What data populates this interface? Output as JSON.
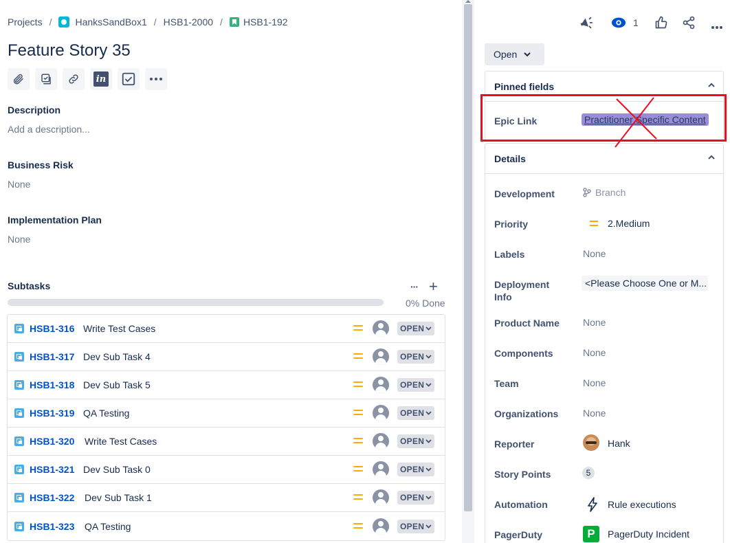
{
  "breadcrumb": {
    "projects": "Projects",
    "project": "HanksSandBox1",
    "epic": "HSB1-2000",
    "issue": "HSB1-192",
    "separator": "/"
  },
  "issue": {
    "title": "Feature Story 35"
  },
  "toolbar": {
    "invision_label": "in",
    "more_label": "···"
  },
  "fields": {
    "description": {
      "label": "Description",
      "value": "Add a description..."
    },
    "business_risk": {
      "label": "Business Risk",
      "value": "None"
    },
    "implementation_plan": {
      "label": "Implementation Plan",
      "value": "None"
    }
  },
  "subtasks": {
    "label": "Subtasks",
    "more_label": "···",
    "add_label": "+",
    "progress_percent": 0,
    "progress_label": "0% Done",
    "status_label": "OPEN",
    "items": [
      {
        "key": "HSB1-316",
        "summary": "Write Test Cases"
      },
      {
        "key": "HSB1-317",
        "summary": "Dev Sub Task 4"
      },
      {
        "key": "HSB1-318",
        "summary": "Dev Sub Task 5"
      },
      {
        "key": "HSB1-319",
        "summary": "QA Testing"
      },
      {
        "key": "HSB1-320",
        "summary": "Write Test Cases"
      },
      {
        "key": "HSB1-321",
        "summary": "Dev Sub Task 0"
      },
      {
        "key": "HSB1-322",
        "summary": "Dev Sub Task 1"
      },
      {
        "key": "HSB1-323",
        "summary": "QA Testing"
      }
    ]
  },
  "top_actions": {
    "watchers_count": "1"
  },
  "status_button": {
    "label": "Open"
  },
  "pinned": {
    "title": "Pinned fields",
    "epic_link_label": "Epic Link",
    "epic_link_value": "Practitioner Specific Content"
  },
  "details": {
    "title": "Details",
    "development": {
      "label": "Development",
      "value": "Branch"
    },
    "priority": {
      "label": "Priority",
      "value": "2.Medium"
    },
    "labels": {
      "label": "Labels",
      "value": "None"
    },
    "deployment_info": {
      "label_line1": "Deployment",
      "label_line2": "Info",
      "value": "<Please Choose One or M..."
    },
    "product_name": {
      "label": "Product Name",
      "value": "None"
    },
    "components": {
      "label": "Components",
      "value": "None"
    },
    "team": {
      "label": "Team",
      "value": "None"
    },
    "organizations": {
      "label": "Organizations",
      "value": "None"
    },
    "reporter": {
      "label": "Reporter",
      "value": "Hank"
    },
    "story_points": {
      "label": "Story Points",
      "value": "5"
    },
    "automation": {
      "label": "Automation",
      "value": "Rule executions"
    },
    "pagerduty": {
      "label": "PagerDuty",
      "value": "PagerDuty Incident",
      "icon_letter": "P"
    }
  },
  "colors": {
    "link": "#0052cc",
    "priority_medium": "#ffab00",
    "epic_badge": "#998dd9",
    "annotation_red": "#e8101c",
    "pagerduty": "#06ac38"
  }
}
